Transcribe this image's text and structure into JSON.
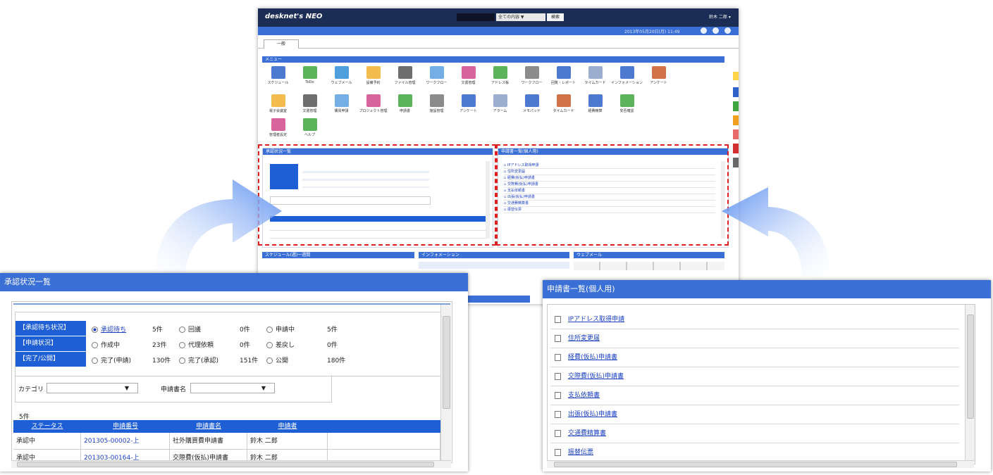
{
  "dashboard": {
    "logo": "desknet's NEO",
    "search_select": "全ての内容 ▼",
    "search_button": "検索",
    "user": "鈴木 二郎 ▾",
    "date": "2013年05月20日(月) 11:49",
    "tab": "一般",
    "portal_title": "メニュー",
    "apps_row1": [
      "スケジュール",
      "ToDo",
      "ウェブメール",
      "設備予約",
      "ファイル管理",
      "ワークフロー",
      "文書管理",
      "アドレス帳",
      "ワークフロー",
      "回覧・レポート",
      "タイムカード",
      "インフォメーション",
      "アンケート"
    ],
    "apps_row2": [
      "電子会議室",
      "文書管理",
      "購買申請",
      "プロジェクト管理",
      "申請書",
      "施設管理",
      "アンケート",
      "アラーム",
      "メモパッド",
      "タイムカード",
      "経費精算",
      "安否確認"
    ],
    "apps_row3": [
      "管理者設定",
      "ヘルプ"
    ],
    "left_panel_title": "承認状況一覧",
    "right_panel_title": "申請書一覧(個人用)",
    "bottom_titles": [
      "スケジュール(週)一週間",
      "インフォメーション",
      "ウェブメール"
    ]
  },
  "approval": {
    "title": "承認状況一覧",
    "rows": [
      {
        "label": "【承認待ち状況】",
        "opts": [
          [
            "承認待ち",
            "5件"
          ],
          [
            "回議",
            "0件"
          ],
          [
            "申請中",
            "5件"
          ]
        ]
      },
      {
        "label": "【申請状況】",
        "opts": [
          [
            "作成中",
            "23件"
          ],
          [
            "代理依頼",
            "0件"
          ],
          [
            "差戻し",
            "0件"
          ]
        ]
      },
      {
        "label": "【完了/公開】",
        "opts": [
          [
            "完了(申請)",
            "130件"
          ],
          [
            "完了(承認)",
            "151件"
          ],
          [
            "公開",
            "180件"
          ]
        ]
      }
    ],
    "category_label": "カテゴリ",
    "form_label": "申請書名",
    "count": "5件",
    "headers": [
      "ステータス",
      "申請番号",
      "申請書名",
      "申請者"
    ],
    "table": [
      [
        "承認中",
        "201305-00002-上",
        "社外購買費申請書",
        "鈴木 二郎"
      ],
      [
        "承認中",
        "201303-00164-上",
        "交際費(仮払)申請書",
        "鈴木 二郎"
      ]
    ]
  },
  "forms": {
    "title": "申請書一覧(個人用)",
    "items": [
      "IPアドレス取得申請",
      "住所変更届",
      "経費(仮払)申請書",
      "交際費(仮払)申請書",
      "支払依頼書",
      "出張(仮払)申請書",
      "交通費精算書",
      "振替伝票"
    ]
  },
  "colors": {
    "accent": "#3a6fd6",
    "header": "#1c2d55",
    "highlight": "#e02020"
  }
}
